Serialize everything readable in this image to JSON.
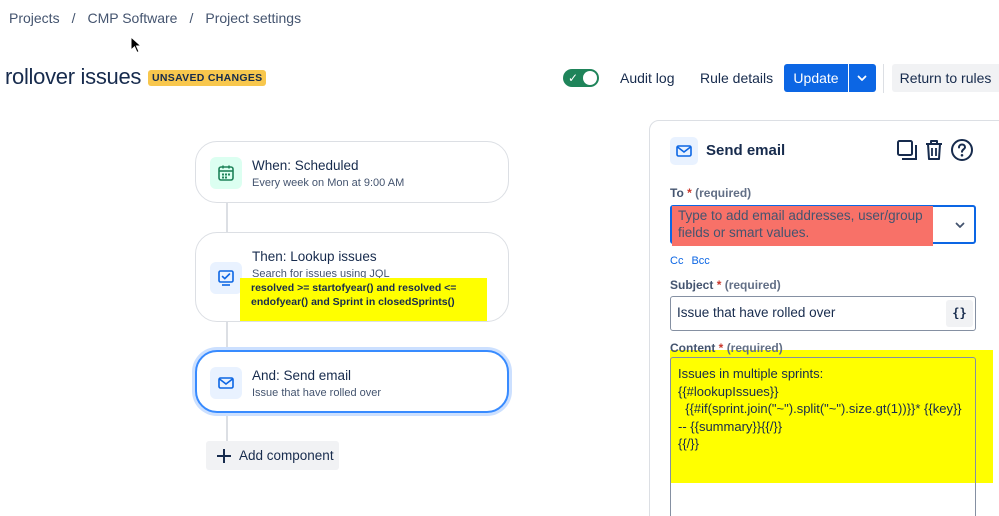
{
  "breadcrumb": {
    "items": [
      "Projects",
      "CMP Software",
      "Project settings"
    ],
    "separator": "/"
  },
  "header": {
    "title": "rollover issues",
    "badge": "UNSAVED CHANGES",
    "toggle_enabled": true,
    "audit_log": "Audit log",
    "rule_details": "Rule details",
    "update": "Update",
    "return_to_rules": "Return to rules"
  },
  "flow": {
    "trigger": {
      "title": "When: Scheduled",
      "subtitle": "Every week on Mon at 9:00 AM",
      "icon": "calendar-icon"
    },
    "lookup": {
      "title": "Then: Lookup issues",
      "subtitle": "Search for issues using JQL",
      "jql": "resolved >= startofyear() and resolved <= endofyear() and Sprint in closedSprints()",
      "icon": "lookup-icon"
    },
    "email": {
      "title": "And: Send email",
      "subtitle": "Issue that have rolled over",
      "icon": "mail-icon"
    },
    "add_component": "Add component"
  },
  "panel": {
    "title": "Send email",
    "to": {
      "label": "To",
      "required_mark": "*",
      "required_text": "(required)",
      "placeholder": "Type to add email addresses, user/group fields or smart values."
    },
    "cc": "Cc",
    "bcc": "Bcc",
    "subject": {
      "label": "Subject",
      "required_mark": "*",
      "required_text": "(required)",
      "value": "Issue that have rolled over",
      "smart_values": "{}"
    },
    "content": {
      "label": "Content",
      "required_mark": "*",
      "required_text": "(required)",
      "value": "Issues in multiple sprints:\n{{#lookupIssues}}\n  {{#if(sprint.join(\"~\").split(\"~\").size.gt(1))}}* {{key}}\n-- {{summary}}{{/}}\n{{/}}"
    }
  },
  "colors": {
    "primary": "#0c66e4",
    "toggle_on": "#1f845a",
    "badge": "#f8c74d",
    "highlight_yellow": "#ffff00",
    "highlight_red": "#f87168"
  }
}
